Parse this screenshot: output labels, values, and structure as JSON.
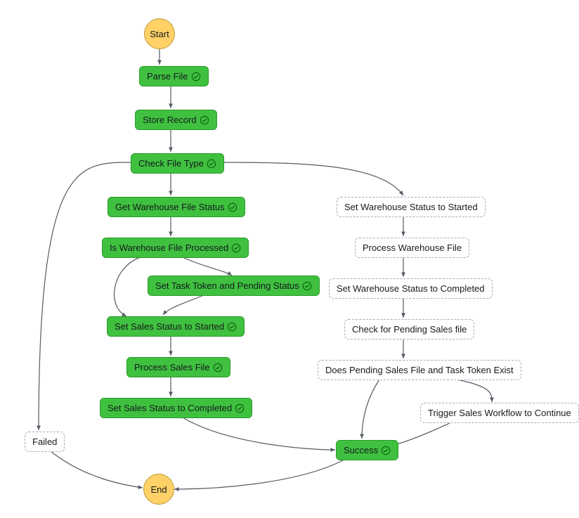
{
  "nodes": {
    "start": "Start",
    "parseFile": "Parse File",
    "storeRecord": "Store Record",
    "checkFileType": "Check File Type",
    "getWhStatus": "Get Warehouse File Status",
    "isWhProcessed": "Is Warehouse File Processed",
    "setTaskToken": "Set Task Token and Pending Status",
    "setSalesStarted": "Set Sales Status to Started",
    "processSales": "Process Sales File",
    "setSalesCompleted": "Set Sales Status to Completed",
    "setWhStarted": "Set Warehouse Status to Started",
    "processWh": "Process Warehouse File",
    "setWhCompleted": "Set Warehouse Status to Completed",
    "checkPending": "Check for Pending Sales file",
    "doesPendingExist": "Does Pending Sales File and Task Token Exist",
    "triggerSales": "Trigger Sales Workflow to Continue",
    "failed": "Failed",
    "success": "Success",
    "end": "End"
  },
  "colors": {
    "green": "#3fc13f",
    "circle": "#ffd166"
  }
}
